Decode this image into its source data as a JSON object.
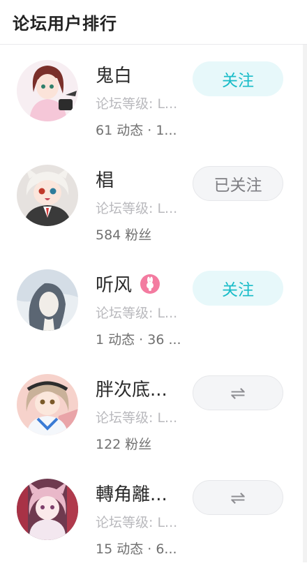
{
  "header": {
    "title": "论坛用户排行"
  },
  "users": [
    {
      "name": "鬼白",
      "level": "论坛等级: L...",
      "stats": "61 动态 · 1...",
      "button": "关注",
      "button_type": "follow",
      "avatar": "avatar-girl-red-hair"
    },
    {
      "name": "椙",
      "level": "论坛等级: L...",
      "stats": "584 粉丝",
      "button": "已关注",
      "button_type": "followed",
      "avatar": "avatar-white-hair-catgirl"
    },
    {
      "name": "听风",
      "level": "论坛等级: L...",
      "stats": "1 动态 · 36 ...",
      "button": "关注",
      "button_type": "follow",
      "avatar": "avatar-blue-haired-girl",
      "badge": "pink-rabbit-badge-icon"
    },
    {
      "name": "胖次底...",
      "level": "论坛等级: L...",
      "stats": "122 粉丝",
      "button": "⇌",
      "button_type": "mutual",
      "avatar": "avatar-blonde-girl-headband"
    },
    {
      "name": "轉角離...",
      "level": "论坛等级: L...",
      "stats": "15 动态 · 6...",
      "button": "⇌",
      "button_type": "mutual",
      "avatar": "avatar-pink-hair-foxgirl"
    }
  ],
  "colors": {
    "accent": "#19bcc8",
    "follow_bg": "#e7f8fa",
    "muted": "#b9b9bd",
    "badge": "#f37ba0"
  }
}
